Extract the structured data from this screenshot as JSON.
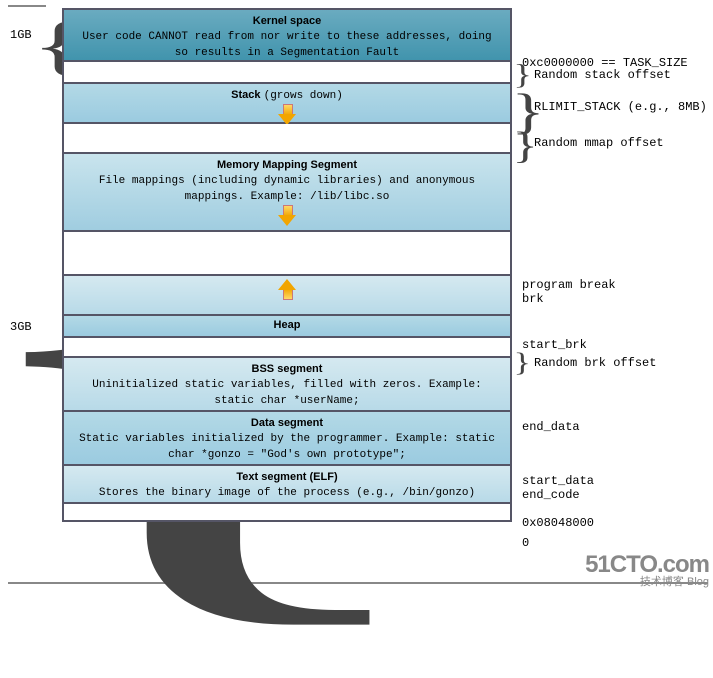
{
  "sizes": {
    "top": "1GB",
    "bottom": "3GB"
  },
  "kernel": {
    "title": "Kernel space",
    "desc": "User code CANNOT read from nor write to these addresses, doing so results in a Segmentation Fault"
  },
  "stack": {
    "title": "Stack",
    "note": "(grows down)"
  },
  "mmap": {
    "title": "Memory Mapping Segment",
    "desc": "File mappings (including dynamic libraries) and anonymous mappings. Example: /lib/libc.so"
  },
  "heap": {
    "title": "Heap"
  },
  "bss": {
    "title": "BSS segment",
    "desc": "Uninitialized static variables, filled with zeros. Example: static char *userName;"
  },
  "data": {
    "title": "Data segment",
    "desc": "Static variables initialized by the programmer. Example: static char *gonzo = \"God's own prototype\";"
  },
  "text": {
    "title": "Text segment (ELF)",
    "desc": "Stores the binary image of the process (e.g., /bin/gonzo)"
  },
  "labels": {
    "task_size": "0xc0000000 == TASK_SIZE",
    "rand_stack": "Random stack offset",
    "rlimit": "RLIMIT_STACK (e.g., 8MB)",
    "rand_mmap": "Random mmap offset",
    "prog_break": "program break",
    "brk": "brk",
    "start_brk": "start_brk",
    "rand_brk": "Random brk offset",
    "end_data": "end_data",
    "start_data": "start_data",
    "end_code": "end_code",
    "text_addr": "0x08048000",
    "zero": "0"
  },
  "watermark": {
    "big": "51CTO.com",
    "small": "技术博客  Blog"
  }
}
